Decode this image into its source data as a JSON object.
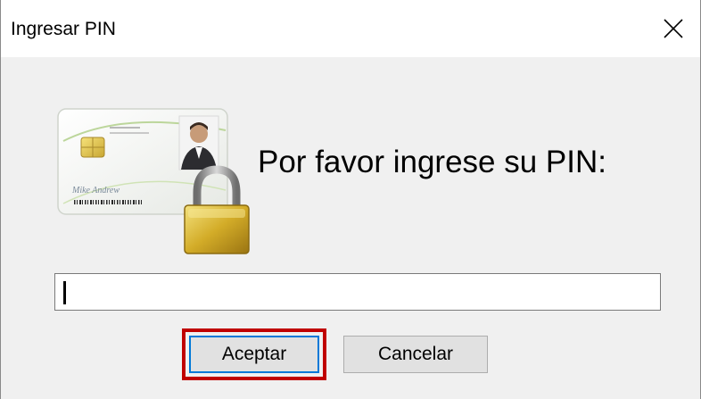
{
  "window": {
    "title": "Ingresar PIN",
    "close_glyph": "✕"
  },
  "dialog": {
    "prompt": "Por favor ingrese su PIN:",
    "pin_value": "",
    "icon": "smartcard-lock-icon",
    "card_name_text": "Mike Andrew"
  },
  "buttons": {
    "accept_label": "Aceptar",
    "cancel_label": "Cancelar"
  },
  "colors": {
    "highlight": "#c00000",
    "dialog_bg": "#f0f0f0",
    "button_bg": "#e1e1e1",
    "focus_border": "#0078d7"
  }
}
